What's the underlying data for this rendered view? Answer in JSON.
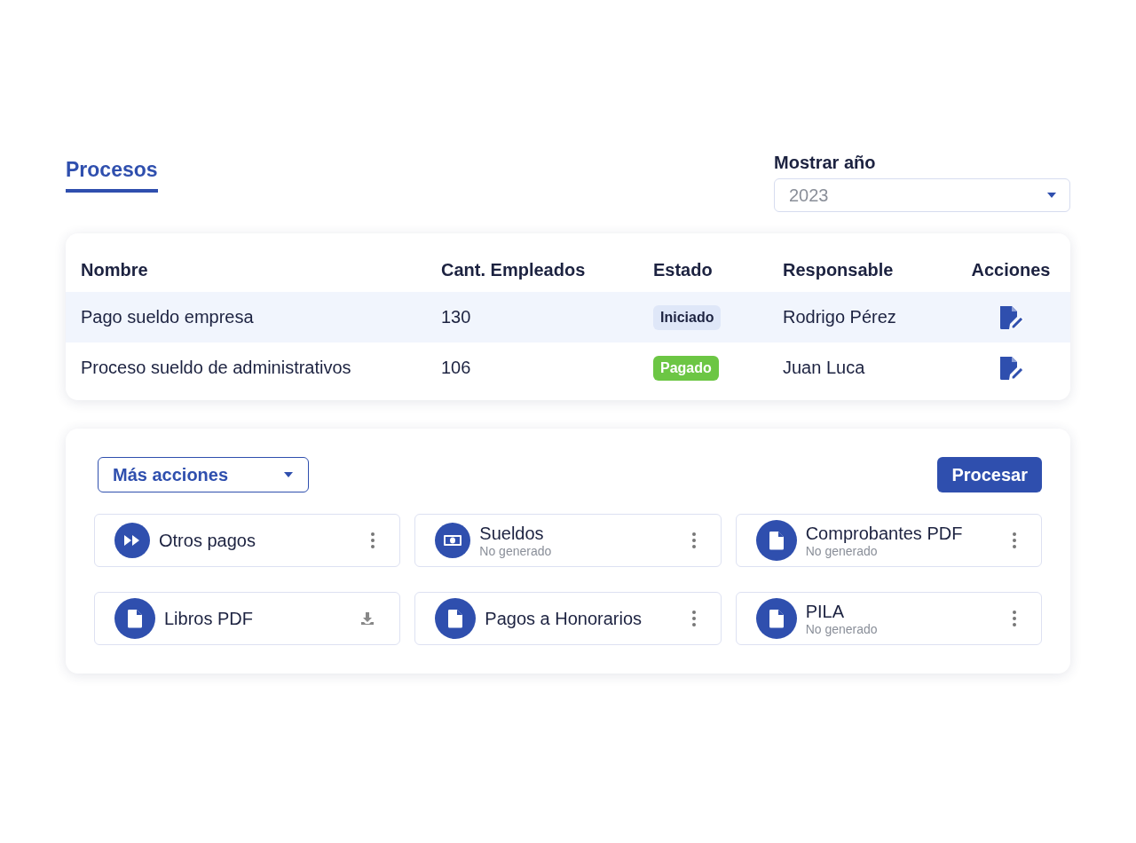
{
  "tabs": [
    {
      "label": "Procesos",
      "selected": true
    }
  ],
  "year_filter": {
    "label": "Mostrar año",
    "value": "2023"
  },
  "table": {
    "columns": [
      "Nombre",
      "Cant. Empleados",
      "Estado",
      "Responsable",
      "Acciones"
    ],
    "rows": [
      {
        "name": "Pago sueldo empresa",
        "employees": "130",
        "status": {
          "label": "Iniciado",
          "color": "#dfe7f8"
        },
        "responsible": "Rodrigo Pérez",
        "selected": true
      },
      {
        "name": "Proceso sueldo de administrativos",
        "employees": "106",
        "status": {
          "label": "Pagado",
          "color": "#6cc644"
        },
        "responsible": "Juan Luca",
        "selected": false
      }
    ]
  },
  "more_actions": {
    "label": "Más acciones"
  },
  "process_button": {
    "label": "Procesar"
  },
  "tiles": [
    {
      "title": "Otros pagos",
      "kind": "forward"
    },
    {
      "title": "Sueldos",
      "subtitle": "No generado",
      "kind": "money"
    },
    {
      "title": "Comprobantes PDF",
      "subtitle": "No generado",
      "kind": "document"
    },
    {
      "title": "Libros PDF",
      "kind": "download"
    },
    {
      "title": "Pagos a Honorarios",
      "kind": "document"
    },
    {
      "title": "PILA",
      "subtitle": "No generado",
      "kind": "document"
    }
  ]
}
